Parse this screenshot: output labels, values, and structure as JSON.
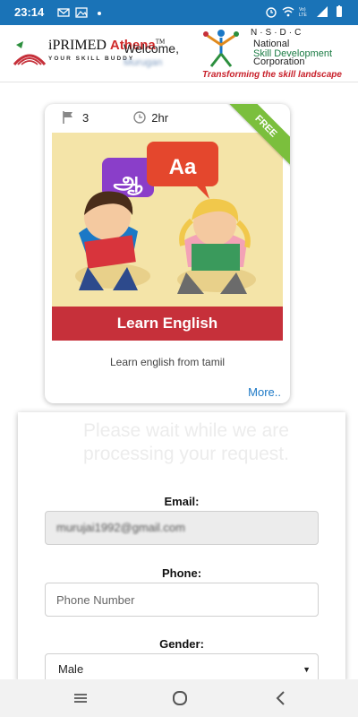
{
  "status_bar": {
    "time": "23:14",
    "icons_left": [
      "mail-icon",
      "gallery-icon",
      "dot-icon"
    ],
    "icons_right": [
      "alarm-icon",
      "wifi-icon",
      "volte-icon",
      "signal-icon",
      "battery-icon"
    ]
  },
  "header": {
    "brand_prefix": "iPRIMED ",
    "brand_accent": "Athena",
    "brand_tm": "TM",
    "brand_tagline": "YOUR SKILL BUDDY",
    "welcome": "Welcome,",
    "username": "Murugan",
    "nsdc_abbr": "N·S·D·C",
    "nsdc_line1": "National",
    "nsdc_line2": "Skill Development",
    "nsdc_line3": "Corporation",
    "nsdc_tagline": "Transforming the skill landscape"
  },
  "course": {
    "lessons": "3",
    "duration": "2hr",
    "ribbon": "FREE",
    "bubble_left": "ஆ",
    "bubble_right": "Aa",
    "title": "Learn English",
    "description": "Learn english from tamil",
    "more_link": "More.."
  },
  "form": {
    "waiting_message": "Please wait while we are processing your request.",
    "email_label": "Email:",
    "email_value": "murujai1992@gmail.com",
    "phone_label": "Phone:",
    "phone_placeholder": "Phone Number",
    "gender_label": "Gender:",
    "gender_value": "Male"
  },
  "nav_bar": {
    "buttons": [
      "recent-apps-icon",
      "home-icon",
      "back-icon"
    ]
  },
  "colors": {
    "status_bar": "#1a73b7",
    "banner_bg": "#f4e4a8",
    "banner_title_bg": "#c6303a",
    "ribbon": "#7bbf3d",
    "link": "#1b78c6"
  }
}
